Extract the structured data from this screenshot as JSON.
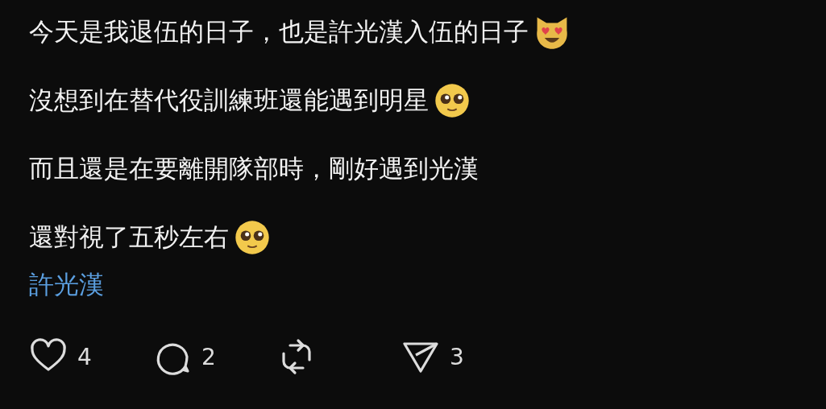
{
  "post": {
    "lines": [
      {
        "text": "今天是我退伍的日子，也是許光漢入伍的日子",
        "emoji": {
          "kind": "cat"
        }
      },
      {
        "text": "沒想到在替代役訓練班還能遇到明星",
        "emoji": {
          "kind": "pleading"
        }
      },
      {
        "text": "而且還是在要離開隊部時，剛好遇到光漢"
      },
      {
        "text": "還對視了五秒左右",
        "emoji": {
          "kind": "pleading"
        }
      }
    ],
    "topic": "許光漢",
    "actions": [
      {
        "kind": "like",
        "count": "4"
      },
      {
        "kind": "reply",
        "count": "2"
      },
      {
        "kind": "repost"
      },
      {
        "kind": "share",
        "count": "3"
      }
    ]
  }
}
